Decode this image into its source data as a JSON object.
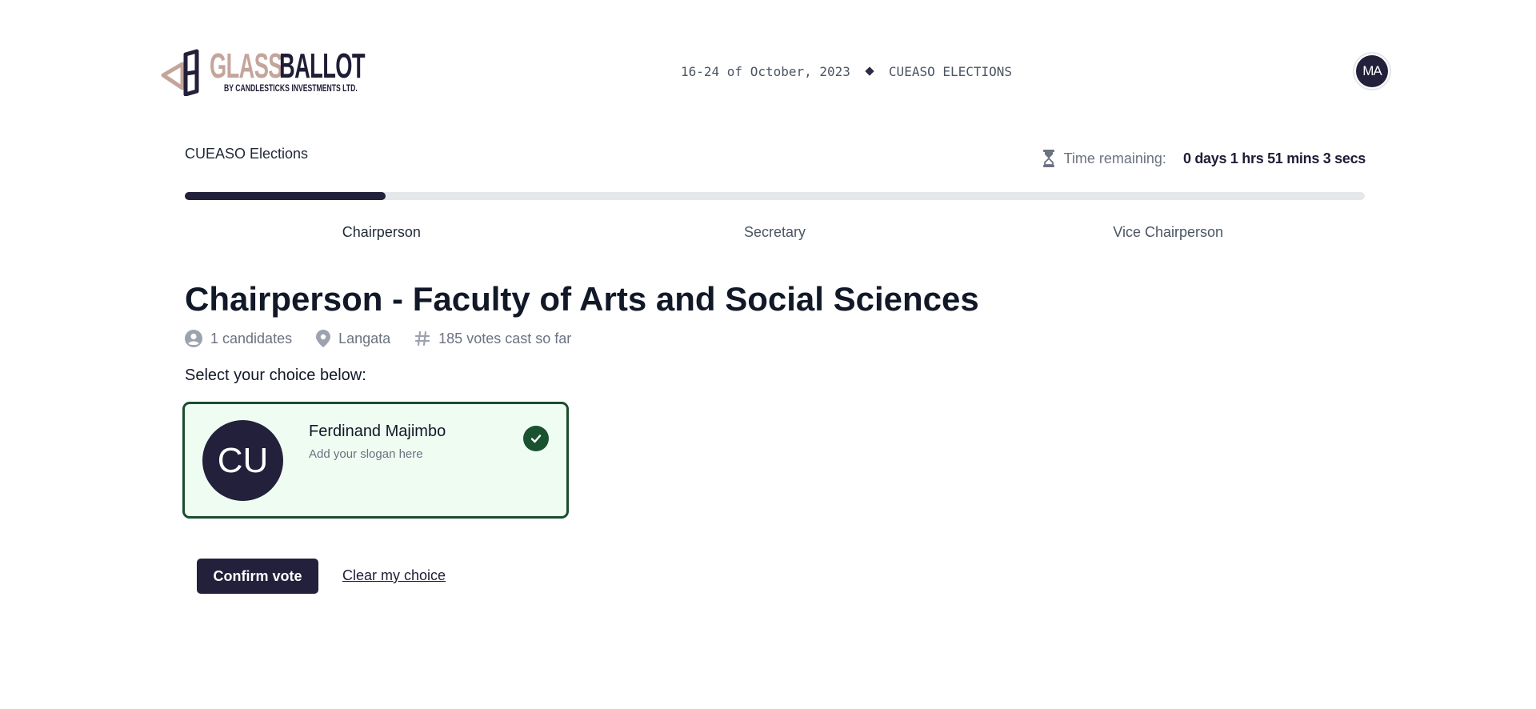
{
  "brand": {
    "name_part1": "GLASS",
    "name_part2": "BALLOT",
    "tagline": "BY CANDLESTICKS INVESTMENTS LTD.",
    "colors": {
      "primary": "#22203a",
      "accent": "#c4a59b"
    }
  },
  "header": {
    "dates": "16-24 of October, 2023",
    "event": "CUEASO ELECTIONS",
    "user_initials": "MA"
  },
  "election": {
    "name": "CUEASO Elections",
    "time_label": "Time remaining:",
    "time_value": "0 days 1 hrs 51 mins 3 secs",
    "progress_fraction": 0.17
  },
  "tabs": [
    {
      "label": "Chairperson",
      "active": true
    },
    {
      "label": "Secretary",
      "active": false
    },
    {
      "label": "Vice Chairperson",
      "active": false
    }
  ],
  "position": {
    "title": "Chairperson - Faculty of Arts and Social Sciences",
    "candidates_count": "1 candidates",
    "location": "Langata",
    "votes_cast": "185 votes cast so far",
    "prompt": "Select your choice below:"
  },
  "candidates": [
    {
      "initials": "CU",
      "name": "Ferdinand Majimbo",
      "slogan": "Add your slogan here",
      "selected": true
    }
  ],
  "actions": {
    "confirm_label": "Confirm vote",
    "clear_label": "Clear my choice"
  }
}
